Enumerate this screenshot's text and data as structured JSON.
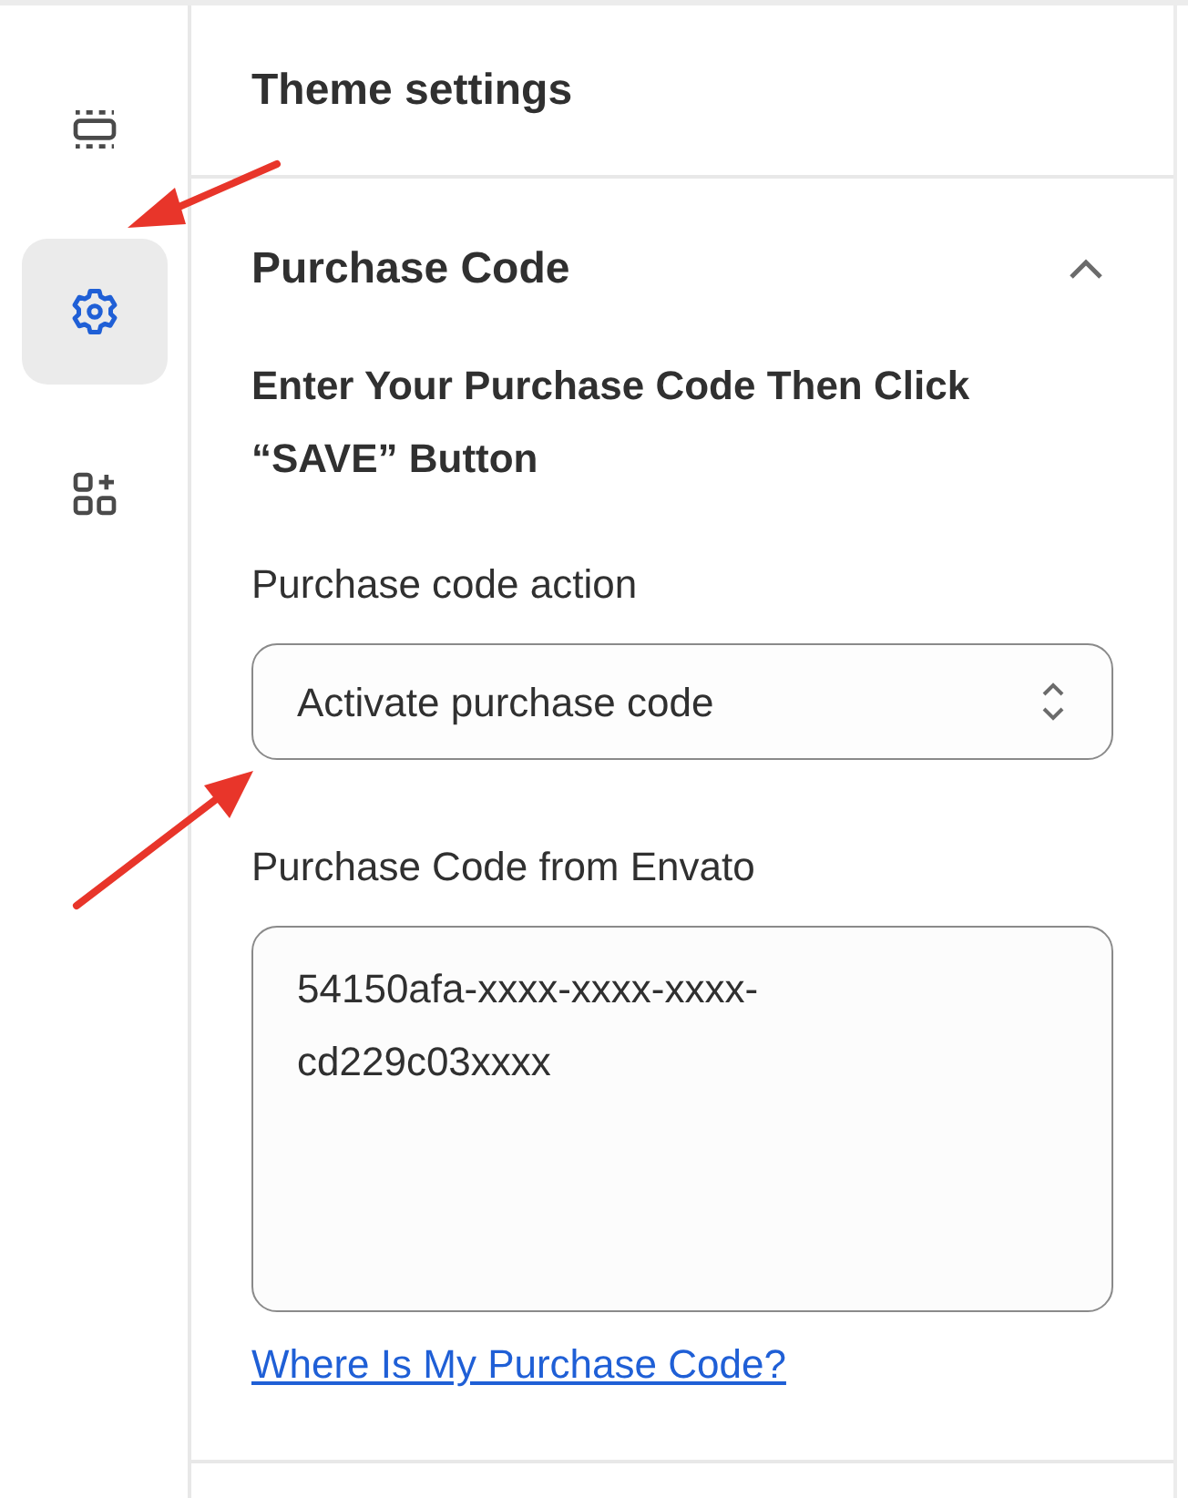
{
  "sidebar": {
    "items": [
      {
        "kind": "sections",
        "selected": false
      },
      {
        "kind": "settings",
        "selected": true
      },
      {
        "kind": "apps",
        "selected": false
      }
    ]
  },
  "header": {
    "title": "Theme settings"
  },
  "section": {
    "title": "Purchase Code",
    "expanded": true,
    "instruction": "Enter Your Purchase Code Then Click “SAVE” Button",
    "action_label": "Purchase code action",
    "action_value": "Activate purchase code",
    "code_label": "Purchase Code from Envato",
    "code_value": "54150afa-xxxx-xxxx-xxxx-cd229c03xxxx",
    "help_link": "Where Is My Purchase Code?"
  }
}
